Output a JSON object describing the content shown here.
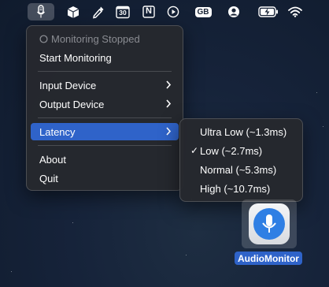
{
  "menubar": {
    "icons": [
      "microphone-icon",
      "cube-icon",
      "eyedropper-icon",
      "calendar-icon",
      "notion-icon",
      "play-icon",
      "keyboard-layout-icon",
      "user-account-icon",
      "battery-charging-icon",
      "wifi-icon"
    ],
    "calendar_day": "30",
    "notion_letter": "N",
    "keyboard_layout": "GB"
  },
  "main_menu": {
    "status": "Monitoring Stopped",
    "items": [
      {
        "label": "Start Monitoring"
      },
      {
        "label": "Input Device"
      },
      {
        "label": "Output Device"
      },
      {
        "label": "Latency"
      },
      {
        "label": "About"
      },
      {
        "label": "Quit"
      }
    ]
  },
  "latency_menu": {
    "items": [
      {
        "label": "Ultra Low (~1.3ms)",
        "checked": false
      },
      {
        "label": "Low (~2.7ms)",
        "checked": true
      },
      {
        "label": "Normal (~5.3ms)",
        "checked": false
      },
      {
        "label": "High (~10.7ms)",
        "checked": false
      }
    ],
    "checkmark": "✓"
  },
  "desktop": {
    "app_label": "AudioMonitor"
  },
  "colors": {
    "accent": "#2f63c9",
    "app_icon_blue": "#2f7fe4"
  }
}
